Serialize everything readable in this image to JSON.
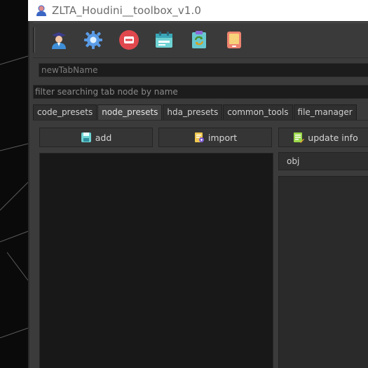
{
  "window": {
    "title": "ZLTA_Houdini__toolbox_v1.0",
    "app_icon": "user-icon"
  },
  "toolbar": {
    "tools": [
      {
        "icon": "user-graduate-icon"
      },
      {
        "icon": "gear-icon"
      },
      {
        "icon": "minus-circle-icon"
      },
      {
        "icon": "calendar-icon"
      },
      {
        "icon": "refresh-clipboard-icon"
      },
      {
        "icon": "tablet-icon"
      }
    ]
  },
  "tab_name_field": {
    "value": "newTabName"
  },
  "filter_field": {
    "placeholder": "filter searching tab node by name"
  },
  "tabs": [
    {
      "label": "code_presets",
      "active": false
    },
    {
      "label": "node_presets",
      "active": true
    },
    {
      "label": "hda_presets",
      "active": false
    },
    {
      "label": "common_tools",
      "active": false
    },
    {
      "label": "file_manager",
      "active": false
    }
  ],
  "actions": {
    "add_label": "add",
    "import_label": "import",
    "update_info_label": "update info"
  },
  "context_select": {
    "value": "obj"
  },
  "colors": {
    "accent_red": "#e0484d",
    "accent_teal": "#4fc8c8",
    "accent_blue": "#4b8fe0"
  }
}
